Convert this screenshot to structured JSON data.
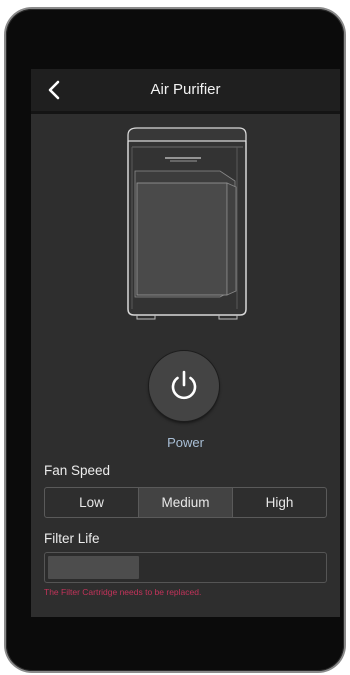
{
  "header": {
    "title": "Air Purifier",
    "back_icon": "chevron-left-icon"
  },
  "device": {
    "image": "air-purifier-illustration"
  },
  "power": {
    "label": "Power",
    "icon": "power-icon"
  },
  "fan_speed": {
    "label": "Fan Speed",
    "options": [
      "Low",
      "Medium",
      "High"
    ],
    "selected": "Medium"
  },
  "filter": {
    "label": "Filter Life",
    "level": 0.33,
    "warning": "The Filter Cartridge needs to be replaced.",
    "warning_color": "#c2335a"
  },
  "colors": {
    "background": "#2e2e2e",
    "header": "#1f1f1f",
    "accent_label": "#a9bfd6"
  }
}
